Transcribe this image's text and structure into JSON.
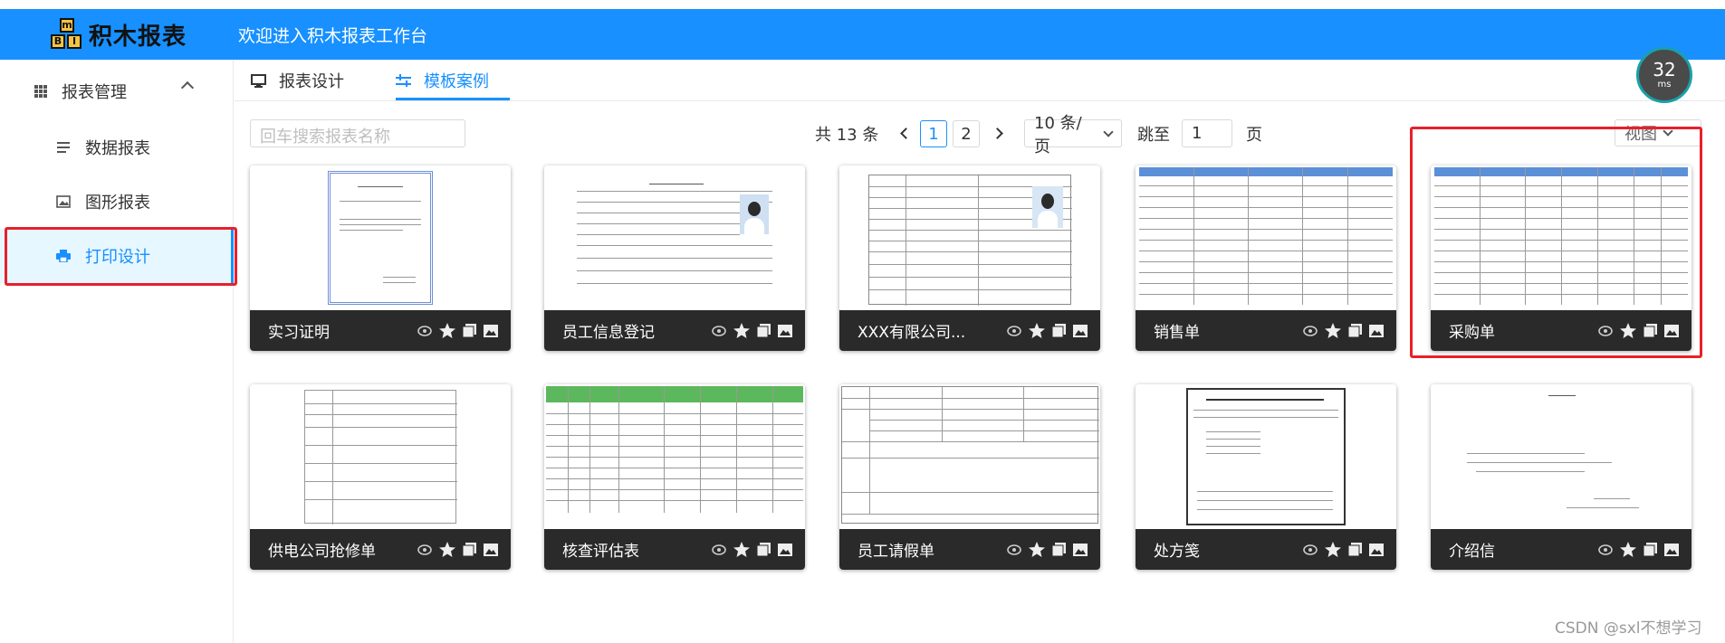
{
  "header": {
    "logo_letters": [
      "m",
      "B",
      "I"
    ],
    "logo_text": "积木报表",
    "welcome": "欢迎进入积木报表工作台"
  },
  "sidebar": {
    "group_label": "报表管理",
    "items": [
      {
        "label": "数据报表",
        "icon": "list-icon"
      },
      {
        "label": "图形报表",
        "icon": "image-icon"
      },
      {
        "label": "打印设计",
        "icon": "printer-icon",
        "active": true
      }
    ]
  },
  "tabs": [
    {
      "label": "报表设计",
      "icon": "monitor-icon"
    },
    {
      "label": "模板案例",
      "icon": "sliders-icon",
      "active": true
    }
  ],
  "toolbar": {
    "search_placeholder": "回车搜索报表名称",
    "total": "共 13 条",
    "pages": [
      "1",
      "2"
    ],
    "current_page": "1",
    "page_size": "10 条/页",
    "jump_label": "跳至",
    "jump_value": "1",
    "page_unit": "页",
    "view_label": "视图"
  },
  "timer": {
    "value": "32",
    "unit": "ms"
  },
  "cards": [
    {
      "title": "实习证明"
    },
    {
      "title": "员工信息登记"
    },
    {
      "title": "XXX有限公司..."
    },
    {
      "title": "销售单"
    },
    {
      "title": "采购单"
    },
    {
      "title": "供电公司抢修单"
    },
    {
      "title": "核查评估表"
    },
    {
      "title": "员工请假单"
    },
    {
      "title": "处方笺"
    },
    {
      "title": "介绍信"
    }
  ],
  "watermark": "CSDN @sxl不想学习",
  "colors": {
    "primary": "#1890ff",
    "highlight": "#e8202a",
    "card_bar": "#2a2a2a"
  }
}
